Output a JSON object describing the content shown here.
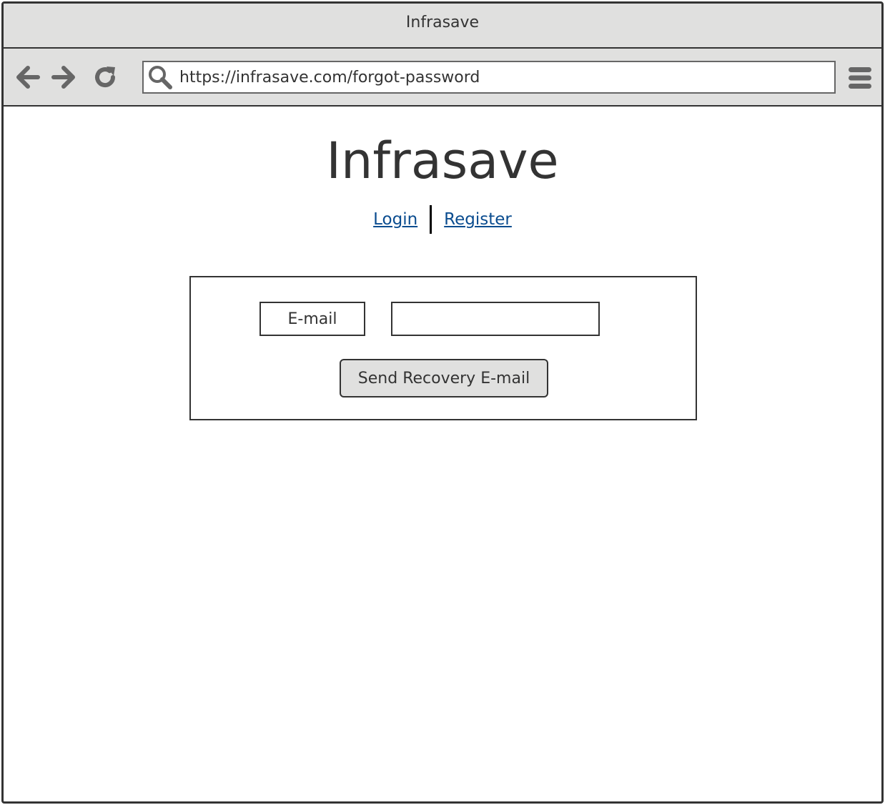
{
  "window": {
    "title": "Infrasave"
  },
  "toolbar": {
    "back_icon": "arrow-left-icon",
    "forward_icon": "arrow-right-icon",
    "reload_icon": "reload-icon",
    "url": "https://infrasave.com/forgot-password",
    "search_icon": "search-icon",
    "menu_icon": "hamburger-menu-icon"
  },
  "page": {
    "brand": "Infrasave",
    "links": {
      "login": "Login",
      "register": "Register"
    },
    "form": {
      "email_label": "E-mail",
      "email_value": "",
      "submit_label": "Send Recovery E-mail"
    }
  },
  "colors": {
    "chrome": "#e0e0df",
    "border": "#333333",
    "icon": "#666666",
    "link": "#0a4c8f"
  }
}
